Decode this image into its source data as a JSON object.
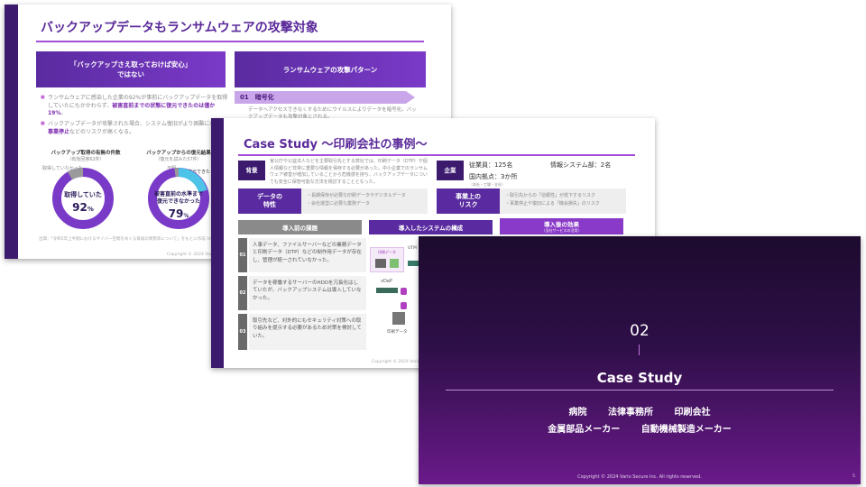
{
  "slide1": {
    "title": "バックアップデータもランサムウェアの攻撃対象",
    "left_header_line1": "「バックアップさえ取っておけば安心」",
    "left_header_line2": "ではない",
    "right_header": "ランサムウェアの攻撃パターン",
    "bullet1_a": "ランサムウェアに感染した企業の92%が事前にバックアップデータを取得していたにもかかわらず、",
    "bullet1_em": "被害直前までの状態に復元できたのは僅か19%",
    "bullet1_b": "。",
    "bullet2_a": "バックアップデータが攻撃された場合、システム復旧がより困難になり、",
    "bullet2_em": "事業停止",
    "bullet2_b": "などのリスクが高くなる。",
    "pattern_label": "01　暗号化",
    "pattern_text": "データへアクセスできなくするためにウイルスによりデータを暗号化。バックアップデータも攻撃対象とされる。",
    "donut1_title": "バックアップ取得の有無の件数",
    "donut1_sub": "（有効回答62件）",
    "donut1_legend": "取得していなかった",
    "donut1_center": "取得していた",
    "donut1_value": "92",
    "donut1_unit": "%",
    "donut2_title": "バックアップからの復元結果",
    "donut2_sub": "（復元を試みた57件）",
    "donut2_legend1": "不明",
    "donut2_legend2": "復元できた",
    "donut2_legend2_val": "19%",
    "donut2_center1": "被害直前の水準まで",
    "donut2_center2": "復元できなかった",
    "donut2_value": "79",
    "donut2_unit": "%",
    "source": "出典：「令和5年上半期におけるサイバー空間をめぐる脅威の情勢等について」をもとに作成 https://www.npa.go.jp/publications/statistics/cybersecurity/data/R05_kami_cyber_jousei.pdf",
    "copyright": "Copyright ©  2024 Vario Secure Inc."
  },
  "slide2": {
    "title": "Case Study ～印刷会社の事例～",
    "bg_label": "背景",
    "bg_text": "官公庁や公益法人などを主要取引先とする弊社では、印刷データ（DTP）や個人情報など非常に重要な情報を保存する必要があった。中小企業でのランサムウェア被害が増加していることから危機感を持ち、バックアップデータについても安全に保管可能な方法を検討することとなった。",
    "company_label": "企業",
    "employees": "従業員：125名",
    "it_staff": "情報システム部：2名",
    "locations": "国内拠点：3か所",
    "locations_note": "（本社・工場・支社）",
    "data_label_1": "データの",
    "data_label_2": "特性",
    "data_text1": "・長期保存が必要な印刷データやデジタルデータ",
    "data_text2": "・会社運営に必要な業務データ",
    "risk_label_1": "事業上の",
    "risk_label_2": "リスク",
    "risk_text1": "・取引先からの「信頼性」が低下するリスク",
    "risk_text2": "・事業停止や復旧による「機会損失」のリスク",
    "phase1": "導入前の課題",
    "phase2": "導入したシステムの構成",
    "phase3": "導入後の効果",
    "phase3_sub": "（当社サービスの活用）",
    "step1": "人事データ、ファイルサーバーなどの業務データと印刷データ（DTP）などの制作用データが存在し、管理が統一されていなかった。",
    "step2": "データを稼働するサーバーのHDDを冗長化はしていたが、バックアップシステムは導入していなかった。",
    "step3": "取引先など、対外的にもセキュリティ対策への取り組みを提示する必要があるため対策を検討していた。",
    "num1": "01",
    "num2": "02",
    "num3": "03",
    "diag_label1": "印刷データ",
    "diag_label2": "UTM",
    "diag_label3": "vDaP",
    "diag_label4": "印刷データ",
    "copyright": "Copyright ©  2024 Vario Secure Inc."
  },
  "slide3": {
    "number": "02",
    "title": "Case Study",
    "row1": [
      "病院",
      "法律事務所",
      "印刷会社"
    ],
    "row2": [
      "金属部品メーカー",
      "自動機械製造メーカー"
    ],
    "copyright": "Copyright ©  2024 Vario Secure Inc.  All rights reserved.",
    "page": "5"
  },
  "colors": {
    "dark_purple": "#3c1a6e",
    "purple": "#5a2ba0",
    "accent": "#a44fd8",
    "light_purple": "#c9a6ea"
  }
}
